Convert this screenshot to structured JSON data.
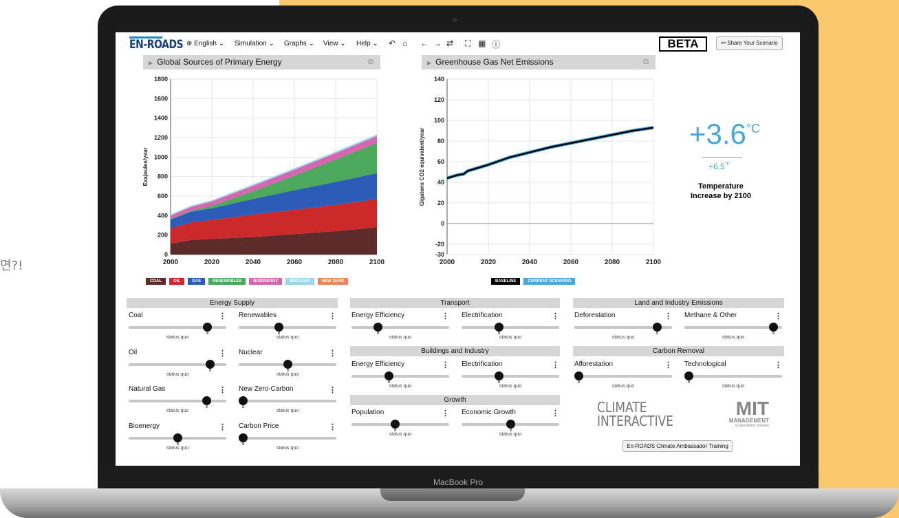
{
  "side_text": "면?!",
  "device": {
    "bezel_label": "MacBook Pro"
  },
  "toolbar": {
    "logo": "EN-ROADS",
    "menus": [
      "⊕ English ⌄",
      "Simulation ⌄",
      "Graphs ⌄",
      "View ⌄",
      "Help ⌄"
    ],
    "icons": [
      "undo-icon",
      "home-icon",
      "arrow-left-icon",
      "arrow-right-icon",
      "compare-icon",
      "fullscreen-icon",
      "table-icon",
      "info-icon"
    ],
    "beta": "BETA",
    "share_label": "Share Your Scenario"
  },
  "left_chart": {
    "title": "Global Sources of Primary Energy",
    "ylabel": "Exajoules/year",
    "legend": [
      {
        "label": "COAL",
        "color": "#5e2b2b"
      },
      {
        "label": "OIL",
        "color": "#cc2a2a"
      },
      {
        "label": "GAS",
        "color": "#2a5cb8"
      },
      {
        "label": "RENEWABLES",
        "color": "#4ca85a"
      },
      {
        "label": "BIOENERGY",
        "color": "#d766b0"
      },
      {
        "label": "NUCLEAR",
        "color": "#9fd4ea"
      },
      {
        "label": "NEW ZERO",
        "color": "#e8875a"
      }
    ]
  },
  "right_chart": {
    "title": "Greenhouse Gas Net Emissions",
    "ylabel": "Gigatons CO2 equivalent/year",
    "legend": [
      {
        "label": "BASELINE",
        "color": "#000000"
      },
      {
        "label": "CURRENT SCENARIO",
        "color": "#4aa8e0"
      }
    ]
  },
  "chart_data": [
    {
      "type": "area",
      "title": "Global Sources of Primary Energy",
      "xlabel": "",
      "ylabel": "Exajoules/year",
      "x": [
        2000,
        2010,
        2020,
        2040,
        2060,
        2080,
        2100
      ],
      "xlim": [
        2000,
        2100
      ],
      "ylim": [
        0,
        1800
      ],
      "xticks": [
        2000,
        2020,
        2040,
        2060,
        2080,
        2100
      ],
      "yticks": [
        0,
        200,
        400,
        600,
        800,
        1000,
        1200,
        1400,
        1600,
        1800
      ],
      "stacked": true,
      "series": [
        {
          "name": "COAL",
          "color": "#5e2b2b",
          "values": [
            110,
            150,
            160,
            180,
            210,
            240,
            280
          ]
        },
        {
          "name": "OIL",
          "color": "#cc2a2a",
          "values": [
            160,
            180,
            195,
            230,
            250,
            270,
            290
          ]
        },
        {
          "name": "GAS",
          "color": "#2a5cb8",
          "values": [
            90,
            110,
            120,
            160,
            200,
            235,
            265
          ]
        },
        {
          "name": "RENEWABLES",
          "color": "#4ca85a",
          "values": [
            5,
            10,
            25,
            80,
            150,
            230,
            310
          ]
        },
        {
          "name": "BIOENERGY",
          "color": "#d766b0",
          "values": [
            35,
            40,
            45,
            55,
            60,
            65,
            70
          ]
        },
        {
          "name": "NUCLEAR",
          "color": "#9fd4ea",
          "values": [
            10,
            12,
            12,
            14,
            15,
            16,
            18
          ]
        },
        {
          "name": "NEW ZERO",
          "color": "#e8875a",
          "values": [
            0,
            0,
            0,
            0,
            0,
            0,
            0
          ]
        }
      ]
    },
    {
      "type": "line",
      "title": "Greenhouse Gas Net Emissions",
      "xlabel": "",
      "ylabel": "Gigatons CO2 equivalent/year",
      "x": [
        2000,
        2005,
        2008,
        2010,
        2015,
        2020,
        2030,
        2040,
        2050,
        2060,
        2070,
        2080,
        2090,
        2100
      ],
      "xlim": [
        2000,
        2100
      ],
      "ylim": [
        -30,
        140
      ],
      "xticks": [
        2000,
        2020,
        2040,
        2060,
        2080,
        2100
      ],
      "yticks": [
        -30,
        -20,
        0,
        20,
        40,
        60,
        80,
        100,
        120,
        140
      ],
      "series": [
        {
          "name": "BASELINE",
          "color": "#000000",
          "values": [
            44,
            47,
            48,
            51,
            54,
            57,
            64,
            69,
            74,
            78,
            82,
            86,
            90,
            93
          ]
        },
        {
          "name": "CURRENT SCENARIO",
          "color": "#4aa8e0",
          "values": [
            44,
            47,
            48,
            51,
            54,
            57,
            64,
            69,
            74,
            78,
            82,
            86,
            90,
            93
          ]
        }
      ]
    }
  ],
  "temperature": {
    "celsius": "+3.6",
    "celsius_unit": "°C",
    "fahrenheit": "+6.5",
    "fahrenheit_unit": "°F",
    "label": "Temperature Increase by 2100"
  },
  "sections": {
    "energy_supply": "Energy Supply",
    "transport": "Transport",
    "land": "Land and Industry Emissions",
    "buildings": "Buildings and Industry",
    "carbon_removal": "Carbon Removal",
    "growth": "Growth"
  },
  "sliders": {
    "coal": {
      "label": "Coal",
      "status": "status quo",
      "level": 0.84
    },
    "renewables": {
      "label": "Renewables",
      "status": "status quo",
      "level": 0.4
    },
    "oil": {
      "label": "Oil",
      "status": "status quo",
      "level": 0.87
    },
    "nuclear": {
      "label": "Nuclear",
      "status": "status quo",
      "level": 0.5
    },
    "natural_gas": {
      "label": "Natural Gas",
      "status": "status quo",
      "level": 0.83
    },
    "new_zero_carbon": {
      "label": "New Zero-Carbon",
      "status": "status quo",
      "level": 0.0
    },
    "bioenergy": {
      "label": "Bioenergy",
      "status": "status quo",
      "level": 0.5
    },
    "carbon_price": {
      "label": "Carbon Price",
      "status": "status quo",
      "level": 0.0
    },
    "transport_efficiency": {
      "label": "Energy Efficiency",
      "status": "status quo",
      "level": 0.25
    },
    "transport_electrification": {
      "label": "Electrification",
      "status": "status quo",
      "level": 0.37
    },
    "buildings_efficiency": {
      "label": "Energy Efficiency",
      "status": "status quo",
      "level": 0.37
    },
    "buildings_electrification": {
      "label": "Electrification",
      "status": "status quo",
      "level": 0.37
    },
    "population": {
      "label": "Population",
      "status": "status quo",
      "level": 0.44
    },
    "economic_growth": {
      "label": "Economic Growth",
      "status": "status quo",
      "level": 0.5
    },
    "deforestation": {
      "label": "Deforestation",
      "status": "status quo",
      "level": 0.88
    },
    "methane": {
      "label": "Methane & Other",
      "status": "status quo",
      "level": 0.95
    },
    "afforestation": {
      "label": "Afforestation",
      "status": "status quo",
      "level": 0.0
    },
    "technological": {
      "label": "Technological",
      "status": "status quo",
      "level": 0.0
    }
  },
  "logos": {
    "ci_line1": "CLIMATE",
    "ci_line2": "INTERACTIVE",
    "mit_big": "MIT",
    "mit_line2": "MANAGEMENT",
    "mit_line3": "Sustainability Initiative"
  },
  "ambassador_label": "En-ROADS Climate Ambassador Training"
}
